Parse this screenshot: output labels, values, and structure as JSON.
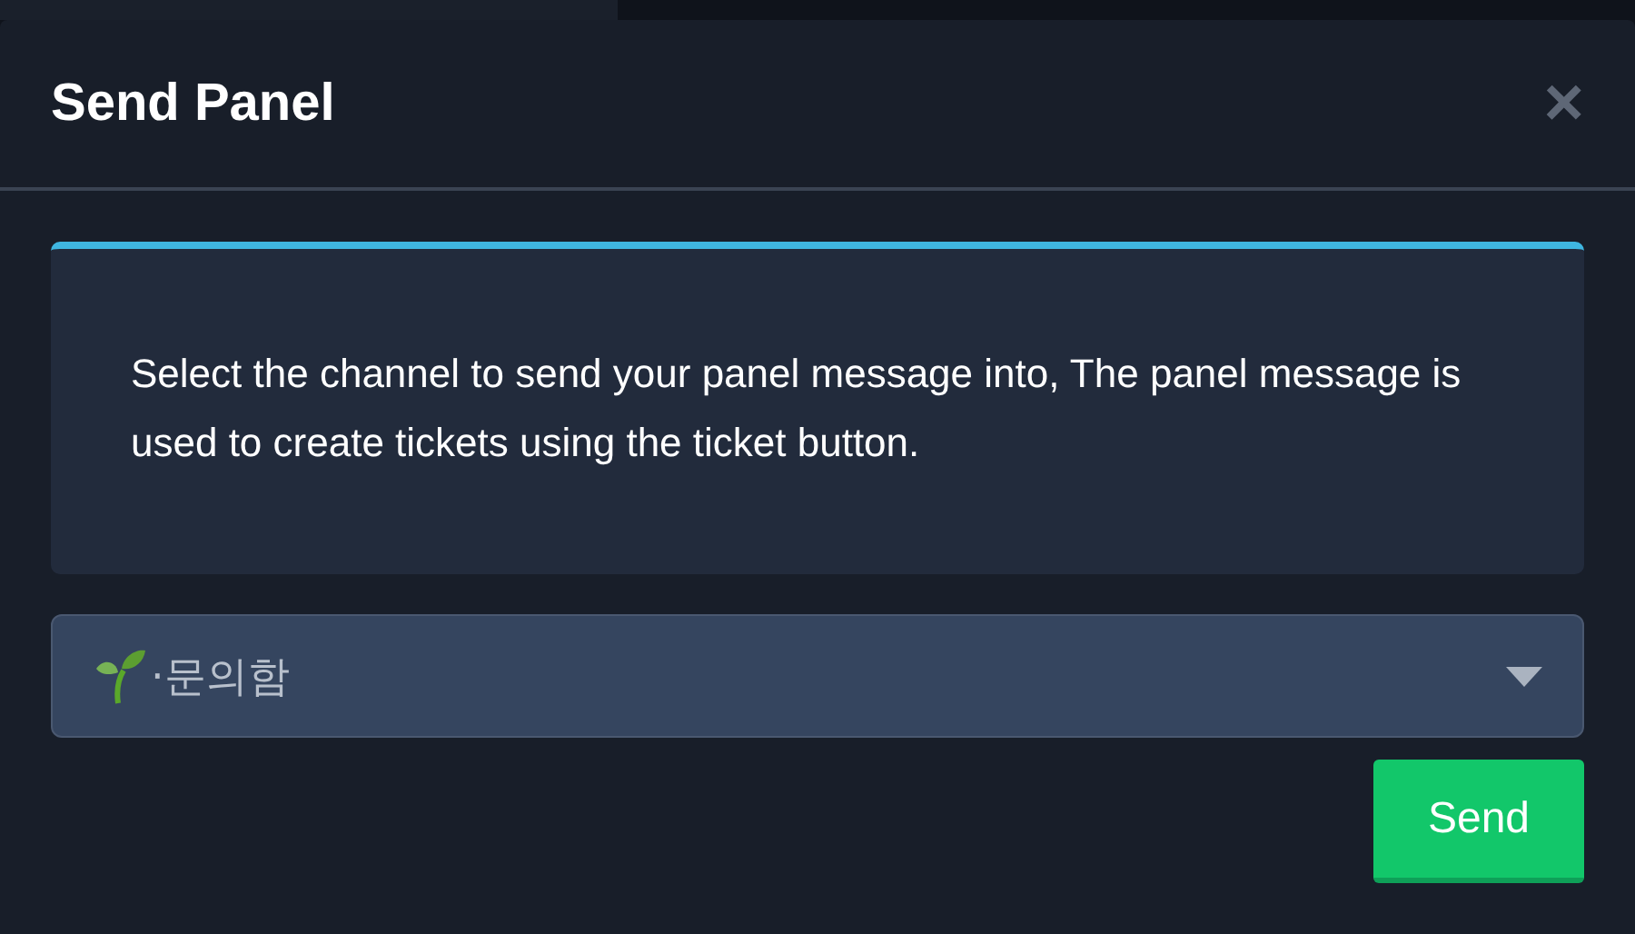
{
  "modal": {
    "title": "Send Panel",
    "close": "×"
  },
  "info": {
    "text": "Select the channel to send your panel message into, The panel message is used to create tickets using the ticket button."
  },
  "channel_select": {
    "value": "·문의함"
  },
  "buttons": [
    "Send"
  ]
}
